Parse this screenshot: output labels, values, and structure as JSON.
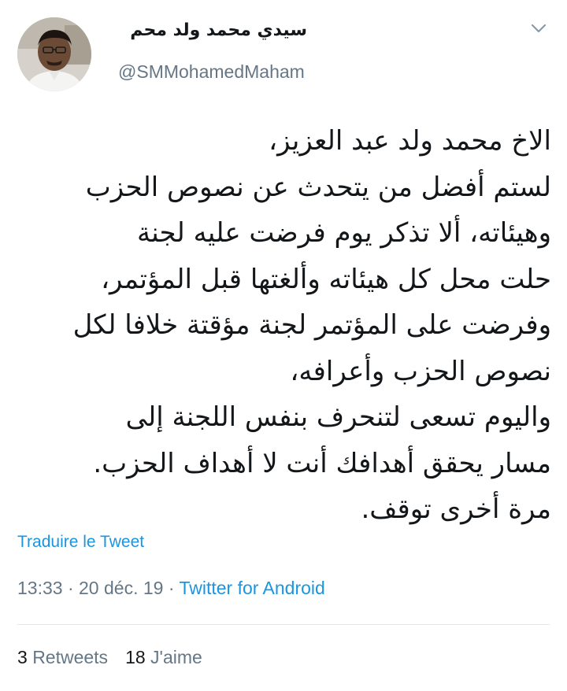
{
  "colors": {
    "primary_text": "#14171a",
    "secondary_text": "#657786",
    "link": "#1b95e0",
    "divider": "#e1e8ed",
    "background": "#ffffff"
  },
  "author": {
    "display_name": "سيدي محمد ولد محم",
    "handle": "@SMMohamedMaham",
    "avatar_icon": "profile-photo"
  },
  "menu_icon": "chevron-down-icon",
  "tweet": {
    "lines": [
      "الاخ محمد ولد عبد العزيز،",
      "لستم أفضل من يتحدث عن نصوص الحزب",
      "وهيئاته، ألا تذكر يوم فرضت عليه لجنة",
      "حلت محل كل هيئاته وألغتها قبل المؤتمر،",
      "وفرضت على المؤتمر لجنة مؤقتة خلافا لكل",
      "نصوص الحزب وأعرافه،",
      "واليوم تسعى لتنحرف بنفس اللجنة إلى",
      "مسار يحقق أهدافك أنت لا أهداف الحزب.",
      "مرة أخرى توقف."
    ]
  },
  "translate_label": "Traduire le Tweet",
  "meta": {
    "time": "13:33",
    "sep1": " · ",
    "date": "20 déc. 19",
    "sep2": " · ",
    "source": "Twitter for Android"
  },
  "stats": {
    "retweets_count": "3",
    "retweets_label": "Retweets",
    "likes_count": "18",
    "likes_label": "J'aime"
  }
}
